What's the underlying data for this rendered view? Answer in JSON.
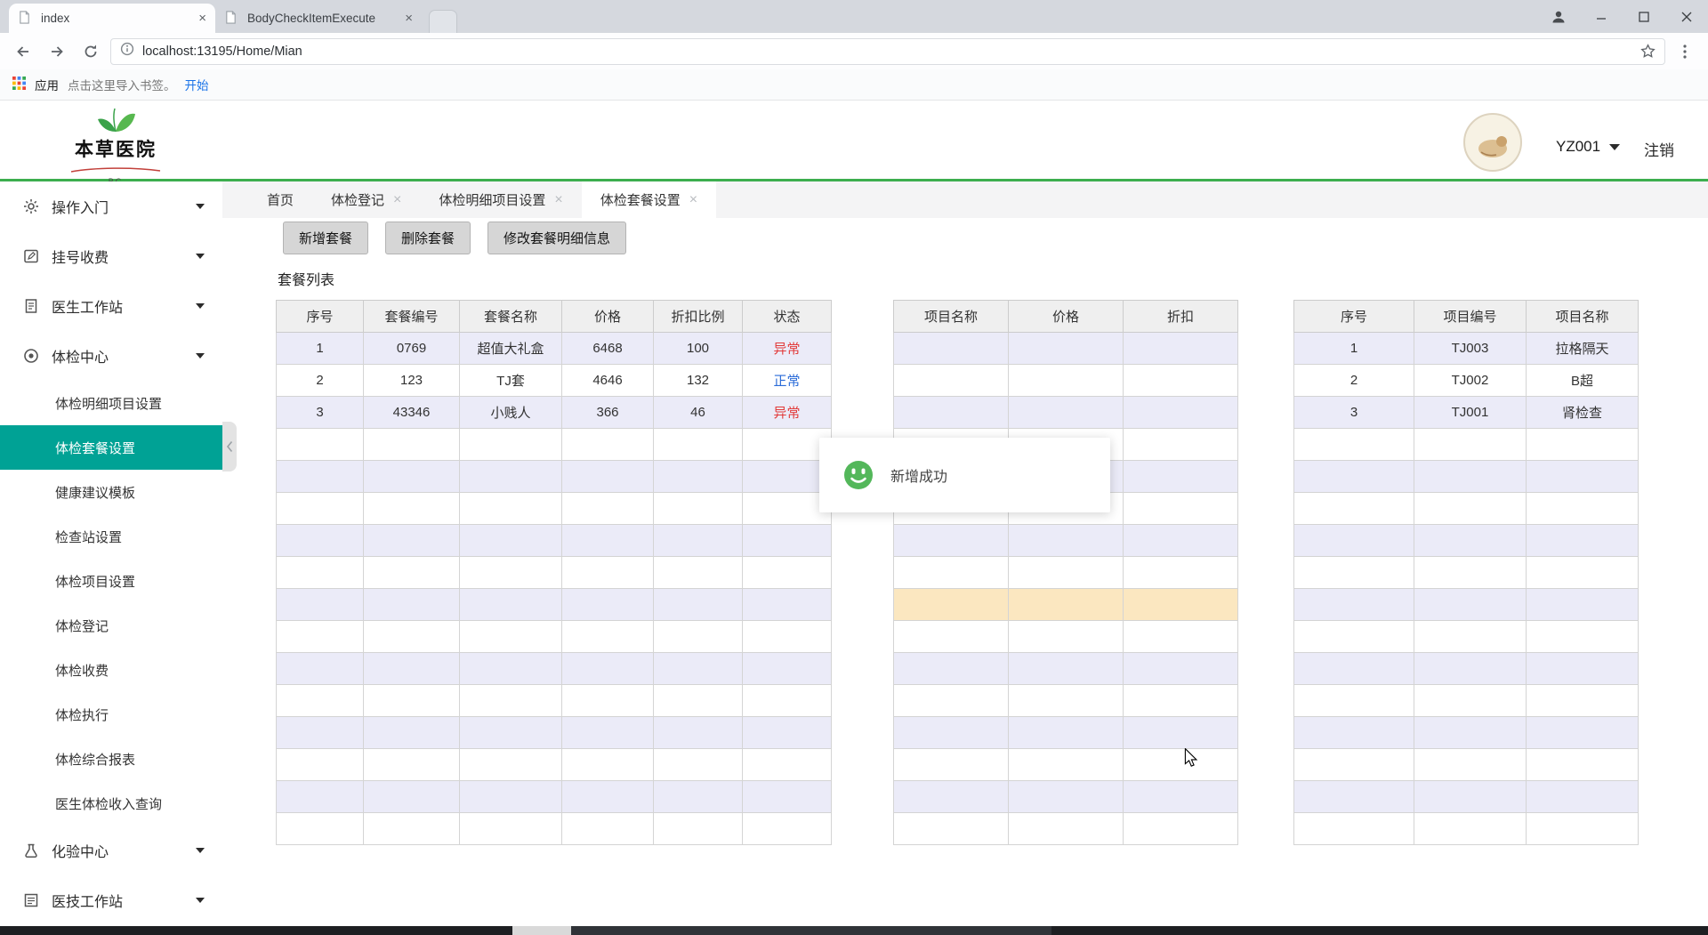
{
  "browser": {
    "tabs": [
      {
        "title": "index"
      },
      {
        "title": "BodyCheckItemExecute"
      }
    ],
    "url": "localhost:13195/Home/Mian",
    "bookmarks_bar": {
      "apps_label": "应用",
      "import_hint": "点击这里导入书签。",
      "start_link": "开始"
    }
  },
  "header": {
    "hospital_name": "本草医院",
    "logo_caption": "BC",
    "username": "YZ001",
    "logout_label": "注销"
  },
  "sidebar": {
    "groups": [
      {
        "label": "操作入门",
        "icon": "gear-icon",
        "children": []
      },
      {
        "label": "挂号收费",
        "icon": "form-icon",
        "children": []
      },
      {
        "label": "医生工作站",
        "icon": "doc-icon",
        "children": []
      },
      {
        "label": "体检中心",
        "icon": "target-icon",
        "active_child_index": 1,
        "children": [
          "体检明细项目设置",
          "体检套餐设置",
          "健康建议模板",
          "检查站设置",
          "体检项目设置",
          "体检登记",
          "体检收费",
          "体检执行",
          "体检综合报表",
          "医生体检收入查询"
        ]
      },
      {
        "label": "化验中心",
        "icon": "flask-icon",
        "children": []
      },
      {
        "label": "医技工作站",
        "icon": "list-icon",
        "children": []
      }
    ]
  },
  "workspace": {
    "page_tabs": [
      {
        "label": "首页",
        "closable": false,
        "active": false
      },
      {
        "label": "体检登记",
        "closable": true,
        "active": false
      },
      {
        "label": "体检明细项目设置",
        "closable": true,
        "active": false
      },
      {
        "label": "体检套餐设置",
        "closable": true,
        "active": true
      }
    ],
    "toolbar_buttons": [
      "新增套餐",
      "删除套餐",
      "修改套餐明细信息"
    ],
    "list_title": "套餐列表",
    "status_colors": {
      "异常": "#e23b3b",
      "正常": "#2a6bd8"
    },
    "tables": {
      "package_table": {
        "headers": [
          "序号",
          "套餐编号",
          "套餐名称",
          "价格",
          "折扣比例",
          "状态"
        ],
        "rows": [
          [
            "1",
            "0769",
            "超值大礼盒",
            "6468",
            "100",
            "异常"
          ],
          [
            "2",
            "123",
            "TJ套",
            "4646",
            "132",
            "正常"
          ],
          [
            "3",
            "43346",
            "小贱人",
            "366",
            "46",
            "异常"
          ]
        ]
      },
      "detail_table": {
        "headers": [
          "项目名称",
          "价格",
          "折扣"
        ],
        "rows": []
      },
      "item_table": {
        "headers": [
          "序号",
          "项目编号",
          "项目名称"
        ],
        "rows": [
          [
            "1",
            "TJ003",
            "拉格隔天"
          ],
          [
            "2",
            "TJ002",
            "B超"
          ],
          [
            "3",
            "TJ001",
            "肾检查"
          ]
        ]
      }
    },
    "toast": {
      "message": "新增成功"
    }
  }
}
